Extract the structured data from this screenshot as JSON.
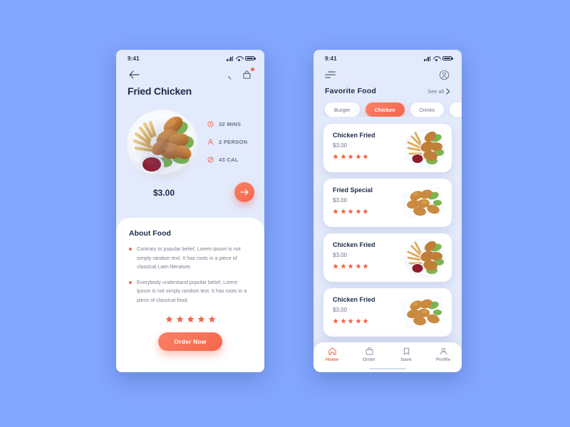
{
  "meta": {
    "background_color": "#82a5fe",
    "accent_color": "#f4674b",
    "screen_bg": "#e3eafb",
    "card_bg": "#ffffff",
    "title_color": "#1d2a47"
  },
  "detail_screen": {
    "status_bar": {
      "time": "9:41",
      "signal_icon": "signal-icon",
      "wifi_icon": "wifi-icon",
      "battery_icon": "battery-icon"
    },
    "nav": {
      "back_icon": "back-arrow-icon",
      "search_icon": "search-icon",
      "bag_icon": "shopping-bag-icon",
      "bag_badge": ""
    },
    "title": "Fried Chicken",
    "hero_image_alt": "fried-chicken-plate",
    "metrics": [
      {
        "icon": "clock-icon",
        "label": "32 MINS"
      },
      {
        "icon": "person-icon",
        "label": "2 PERSON"
      },
      {
        "icon": "calorie-icon",
        "label": "43 CAL"
      }
    ],
    "price": "$3.00",
    "next_button_icon": "arrow-right-icon",
    "about": {
      "heading": "About Food",
      "bullets": [
        "Contrary to popular belief, Lorem Ipsum is not simply random text. It has roots in a piece of classical Latin literature.",
        "Everybody understand popular belief, Lorem Ipsum is not simply random text. It has roots in a piece of classical food."
      ],
      "rating": 5,
      "order_button": "Order Now"
    }
  },
  "list_screen": {
    "status_bar": {
      "time": "9:41",
      "signal_icon": "signal-icon",
      "wifi_icon": "wifi-icon",
      "battery_icon": "battery-icon"
    },
    "nav": {
      "menu_icon": "hamburger-menu-icon",
      "profile_icon": "user-circle-icon"
    },
    "header": {
      "title": "Favorite  Food",
      "see_all": "See all",
      "chevron_icon": "chevron-right-icon"
    },
    "categories": [
      {
        "label": "Burger",
        "active": false
      },
      {
        "label": "Chicken",
        "active": true
      },
      {
        "label": "Drinks",
        "active": false
      },
      {
        "label": "",
        "active": false
      }
    ],
    "foods": [
      {
        "name": "Chicken Fried",
        "price": "$3.00",
        "rating": 5,
        "image_alt": "chicken-fries-plate"
      },
      {
        "name": "Fried Special",
        "price": "$3.00",
        "rating": 5,
        "image_alt": "fried-nuggets-tray"
      },
      {
        "name": "Chicken Fried",
        "price": "$3.00",
        "rating": 5,
        "image_alt": "chicken-fries-plate"
      },
      {
        "name": "Chicken Fried",
        "price": "$3.00",
        "rating": 5,
        "image_alt": "fried-nuggets-tray"
      }
    ],
    "bottom_nav": [
      {
        "label": "Home",
        "icon": "home-icon",
        "active": true
      },
      {
        "label": "Order",
        "icon": "bag-icon",
        "active": false
      },
      {
        "label": "Save",
        "icon": "bookmark-icon",
        "active": false
      },
      {
        "label": "Profile",
        "icon": "person-icon",
        "active": false
      }
    ]
  }
}
